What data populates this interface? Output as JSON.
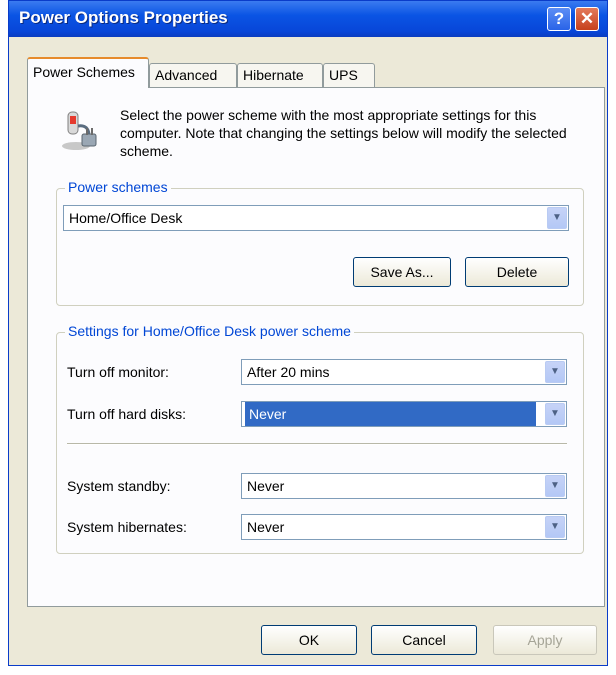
{
  "window": {
    "title": "Power Options Properties"
  },
  "title_buttons": {
    "help": "?",
    "close": "✕"
  },
  "tabs": [
    {
      "label": "Power Schemes",
      "active": true
    },
    {
      "label": "Advanced",
      "active": false
    },
    {
      "label": "Hibernate",
      "active": false
    },
    {
      "label": "UPS",
      "active": false
    }
  ],
  "intro": {
    "icon": "power-scheme-icon",
    "text": "Select the power scheme with the most appropriate settings for this computer. Note that changing the settings below will modify the selected scheme."
  },
  "schemes": {
    "legend": "Power schemes",
    "selected": "Home/Office Desk",
    "save_as": "Save As...",
    "delete": "Delete"
  },
  "settings": {
    "legend": "Settings for Home/Office Desk power scheme",
    "monitor": {
      "label": "Turn off monitor:",
      "value": "After 20 mins"
    },
    "hard_disks": {
      "label": "Turn off hard disks:",
      "value": "Never"
    },
    "standby": {
      "label": "System standby:",
      "value": "Never"
    },
    "hibernate": {
      "label": "System hibernates:",
      "value": "Never"
    }
  },
  "footer": {
    "ok": "OK",
    "cancel": "Cancel",
    "apply": "Apply"
  },
  "colors": {
    "titlebar": "#0a54e4",
    "selection": "#316ac5",
    "accent_tab": "#e68b2c"
  }
}
